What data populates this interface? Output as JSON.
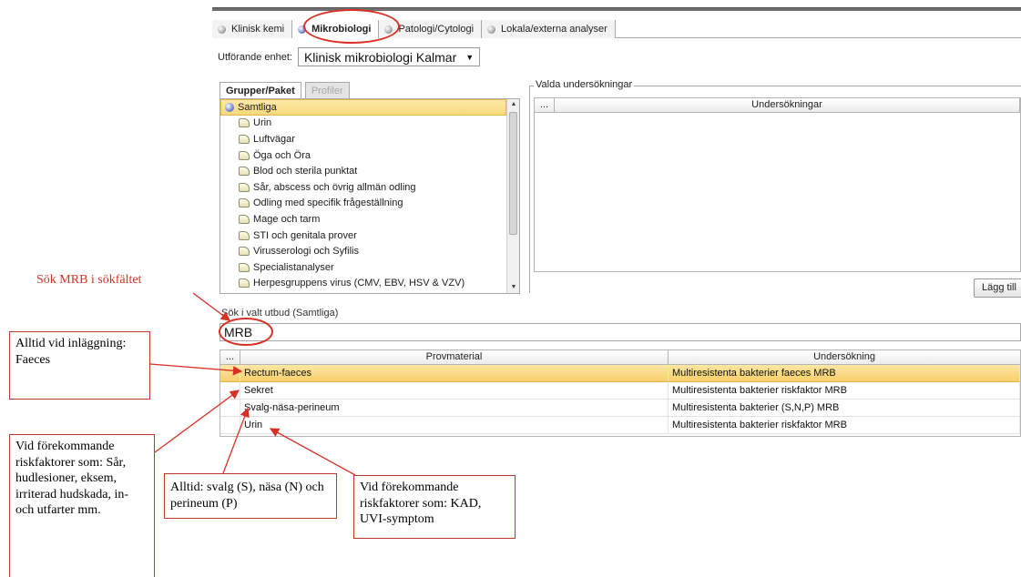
{
  "tabs": [
    {
      "label": "Klinisk kemi",
      "active": false
    },
    {
      "label": "Mikrobiologi",
      "active": true
    },
    {
      "label": "Patologi/Cytologi",
      "active": false
    },
    {
      "label": "Lokala/externa analyser",
      "active": false
    }
  ],
  "unit": {
    "label": "Utförande enhet:",
    "value": "Klinisk mikrobiologi Kalmar"
  },
  "group_tabs": {
    "groups": "Grupper/Paket",
    "profiles": "Profiler"
  },
  "tree": {
    "root": "Samtliga",
    "items": [
      "Urin",
      "Luftvägar",
      "Öga och Öra",
      "Blod och sterila punktat",
      "Sår, abscess och övrig allmän odling",
      "Odling med specifik frågeställning",
      "Mage och tarm",
      "STI och genitala prover",
      "Virusserologi och Syfilis",
      "Specialistanalyser",
      "Herpesgruppens virus (CMV, EBV, HSV & VZV)"
    ]
  },
  "selected_panel": {
    "legend": "Valda undersökningar",
    "col_dots": "...",
    "column": "Undersökningar",
    "add_button": "Lägg till"
  },
  "search": {
    "label": "Sök i valt utbud (Samtliga)",
    "value": "MRB"
  },
  "results": {
    "col_dots": "...",
    "columns": [
      "Provmaterial",
      "Undersökning"
    ],
    "rows": [
      {
        "material": "Rectum-faeces",
        "test": "Multiresistenta bakterier faeces MRB",
        "selected": true
      },
      {
        "material": "Sekret",
        "test": "Multiresistenta bakterier riskfaktor MRB",
        "selected": false
      },
      {
        "material": "Svalg-näsa-perineum",
        "test": "Multiresistenta bakterier (S,N,P) MRB",
        "selected": false
      },
      {
        "material": "Urin",
        "test": "Multiresistenta bakterier riskfaktor MRB",
        "selected": false
      }
    ]
  },
  "annotations": {
    "search_hint": "Sök MRB i sökfältet",
    "faeces": "Alltid vid inläggning: Faeces",
    "wounds": "Vid förekommande riskfaktorer som: Sår, hudlesioner, eksem, irriterad hudskada, in- och utfarter mm.",
    "snp": "Alltid: svalg (S), näsa (N) och perineum (P)",
    "urine": "Vid förekommande riskfaktorer som: KAD, UVI-symptom"
  },
  "colors": {
    "annotation_red": "#d93025",
    "selected_row": "#f7cf6b"
  }
}
